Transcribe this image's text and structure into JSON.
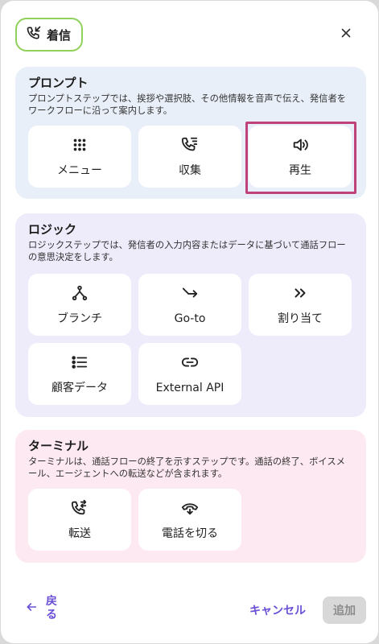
{
  "header": {
    "badge_label": "着信",
    "badge_icon": "phone-incoming-icon",
    "close_icon": "close-icon",
    "badge_border_color": "#8fd15b"
  },
  "sections": {
    "prompt": {
      "title": "プロンプト",
      "description": "プロンプトステップでは、挨拶や選択肢、その他情報を音声で伝え、発信者をワークフローに沿って案内します。",
      "background": "#e9eff8",
      "items": [
        {
          "label": "メニュー",
          "icon": "keypad-icon"
        },
        {
          "label": "収集",
          "icon": "phone-collect-icon"
        },
        {
          "label": "再生",
          "icon": "speaker-icon",
          "highlighted": true
        }
      ]
    },
    "logic": {
      "title": "ロジック",
      "description": "ロジックステップでは、発信者の入力内容またはデータに基づいて通話フローの意思決定をします。",
      "background": "#eeebfb",
      "items": [
        {
          "label": "ブランチ",
          "icon": "branch-icon"
        },
        {
          "label": "Go-to",
          "icon": "goto-arrow-icon"
        },
        {
          "label": "割り当て",
          "icon": "double-chevron-right-icon"
        },
        {
          "label": "顧客データ",
          "icon": "list-icon"
        },
        {
          "label": "External API",
          "icon": "link-icon"
        }
      ]
    },
    "terminal": {
      "title": "ターミナル",
      "description": "ターミナルは、通話フローの終了を示すステップです。通話の終了、ボイスメール、エージェントへの転送などが含まれます。",
      "background": "#fde9f1",
      "items": [
        {
          "label": "転送",
          "icon": "phone-transfer-icon"
        },
        {
          "label": "電話を切る",
          "icon": "hang-up-icon"
        }
      ]
    }
  },
  "footer": {
    "back_label": "戻る",
    "cancel_label": "キャンセル",
    "add_label": "追加",
    "accent_color": "#6a4fd6"
  }
}
